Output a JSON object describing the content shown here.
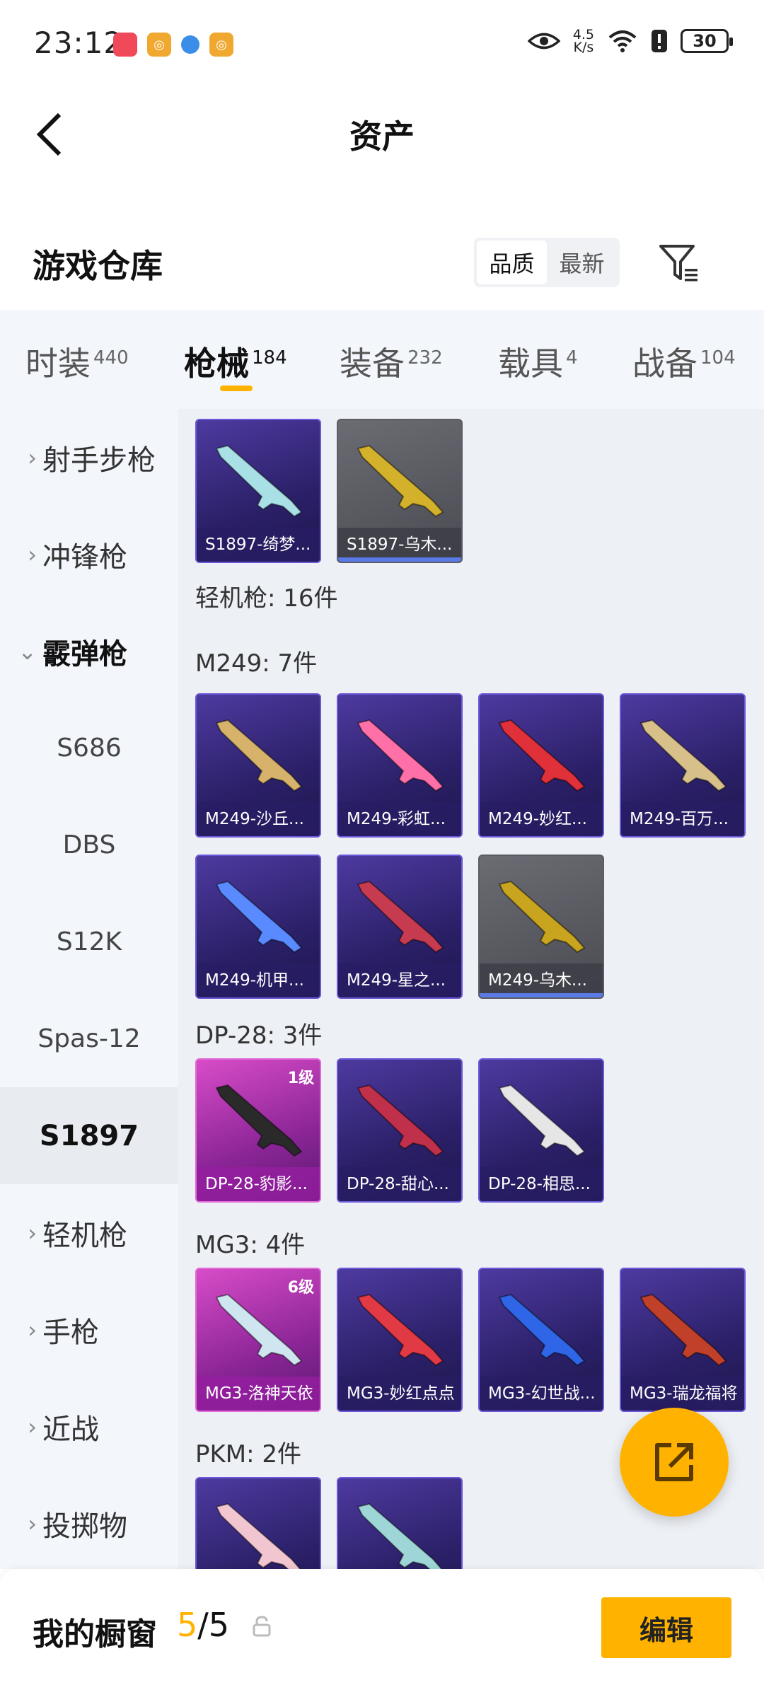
{
  "status_bar": {
    "time": "23:12",
    "net_speed_top": "4.5",
    "net_speed_unit": "K/s",
    "battery": "30"
  },
  "header": {
    "title": "资产"
  },
  "section": {
    "title": "游戏仓库",
    "sort_options": [
      "品质",
      "最新"
    ]
  },
  "tabs": [
    {
      "label": "时装",
      "count": "440"
    },
    {
      "label": "枪械",
      "count": "184"
    },
    {
      "label": "装备",
      "count": "232"
    },
    {
      "label": "载具",
      "count": "4"
    },
    {
      "label": "战备",
      "count": "104"
    }
  ],
  "sidebar": {
    "items": [
      {
        "label": "射手步枪",
        "chevron": "›"
      },
      {
        "label": "冲锋枪",
        "chevron": "›"
      },
      {
        "label": "霰弹枪",
        "chevron": "⌄"
      },
      {
        "label": "S686"
      },
      {
        "label": "DBS"
      },
      {
        "label": "S12K"
      },
      {
        "label": "Spas-12"
      },
      {
        "label": "S1897"
      },
      {
        "label": "轻机枪",
        "chevron": "›"
      },
      {
        "label": "手枪",
        "chevron": "›"
      },
      {
        "label": "近战",
        "chevron": "›"
      },
      {
        "label": "投掷物",
        "chevron": "›"
      }
    ]
  },
  "content": {
    "groups": [
      {
        "label": "轻机枪: 16件"
      },
      {
        "label": "M249: 7件"
      },
      {
        "label": "DP-28: 3件"
      },
      {
        "label": "MG3: 4件"
      },
      {
        "label": "PKM: 2件"
      }
    ],
    "cards": [
      {
        "name": "S1897-绮梦...",
        "style": "purple",
        "gun_color": "#a8e0e6"
      },
      {
        "name": "S1897-乌木...",
        "style": "gray",
        "gun_color": "#d4b12a"
      },
      {
        "name": "M249-沙丘...",
        "style": "purple",
        "gun_color": "#d6b26a"
      },
      {
        "name": "M249-彩虹...",
        "style": "purple",
        "gun_color": "#ff6fa8"
      },
      {
        "name": "M249-妙红...",
        "style": "purple",
        "gun_color": "#e0303a"
      },
      {
        "name": "M249-百万...",
        "style": "purple",
        "gun_color": "#d8c08a"
      },
      {
        "name": "M249-机甲...",
        "style": "purple",
        "gun_color": "#5a8aff"
      },
      {
        "name": "M249-星之...",
        "style": "purple",
        "gun_color": "#c63b50"
      },
      {
        "name": "M249-乌木...",
        "style": "gray",
        "gun_color": "#c9a41e"
      },
      {
        "name": "DP-28-豹影...",
        "style": "pink",
        "gun_color": "#2a2a2a",
        "level": "1级"
      },
      {
        "name": "DP-28-甜心...",
        "style": "purple",
        "gun_color": "#c0304a"
      },
      {
        "name": "DP-28-相思...",
        "style": "purple",
        "gun_color": "#e6e6e6"
      },
      {
        "name": "MG3-洛神天依",
        "style": "pink",
        "gun_color": "#cfe6f0",
        "level": "6级"
      },
      {
        "name": "MG3-妙红点点",
        "style": "purple",
        "gun_color": "#e23a44"
      },
      {
        "name": "MG3-幻世战...",
        "style": "purple",
        "gun_color": "#2f66e8"
      },
      {
        "name": "MG3-瑞龙福将",
        "style": "purple",
        "gun_color": "#c0402a"
      },
      {
        "name": "",
        "style": "purple",
        "gun_color": "#f2c6d0"
      },
      {
        "name": "",
        "style": "purple",
        "gun_color": "#9ed6d8"
      }
    ]
  },
  "bottom_bar": {
    "label": "我的橱窗",
    "count_current": "5",
    "count_total": "/5",
    "edit_label": "编辑"
  },
  "colors": {
    "accent": "#ffb300",
    "card_purple": "#2b2068",
    "card_pink": "#8b2597",
    "card_gray": "#4a4b52"
  }
}
